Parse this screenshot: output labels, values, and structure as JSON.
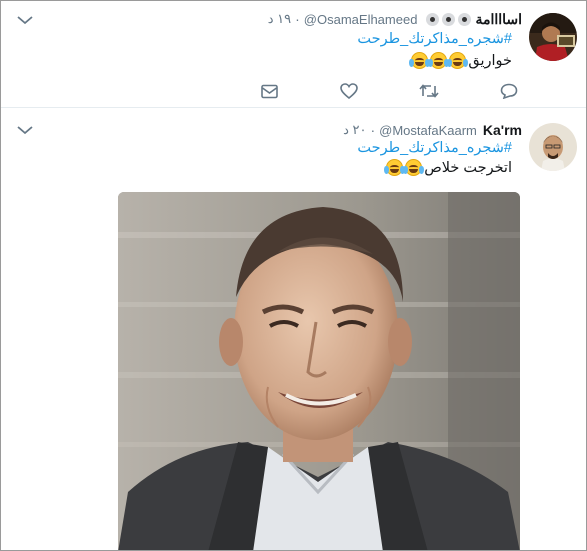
{
  "tweets": [
    {
      "name": "اساااامة",
      "handle": "@OsamaElhameed",
      "time": "١٩ د",
      "hashtag": "#شجره_مذاكرتك_طرحت",
      "text": "خواريق",
      "emoji_count": 3,
      "emoji_name": "face-with-tears-of-joy"
    },
    {
      "name": "Ka'rm",
      "handle": "@MostafaKaarm",
      "time": "٢٠ د",
      "hashtag": "#شجره_مذاكرتك_طرحت",
      "text": "اتخرجت خلاص",
      "emoji_count": 2,
      "emoji_name": "face-with-tears-of-joy"
    }
  ],
  "actions": [
    "reply-icon",
    "retweet-icon",
    "like-icon",
    "dm-icon"
  ],
  "colors": {
    "link": "#1b95e0",
    "muted": "#657786",
    "icon": "#657786",
    "divider": "#e6ecf0"
  }
}
